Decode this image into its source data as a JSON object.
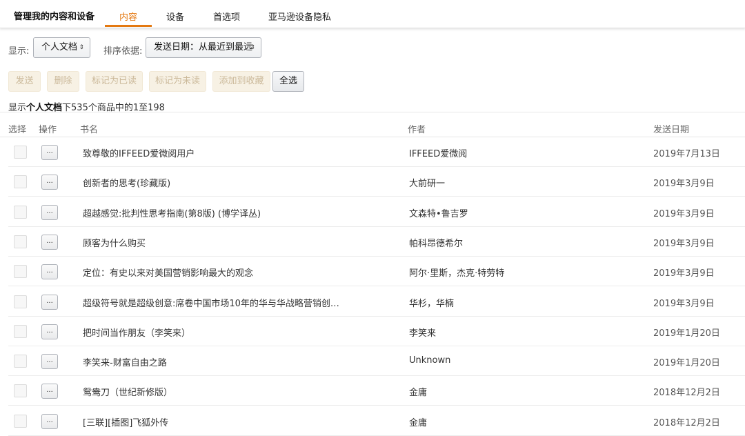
{
  "header": {
    "title": "管理我的内容和设备",
    "tabs": [
      {
        "label": "内容",
        "active": true
      },
      {
        "label": "设备",
        "active": false
      },
      {
        "label": "首选项",
        "active": false
      },
      {
        "label": "亚马逊设备隐私",
        "active": false
      }
    ]
  },
  "filters": {
    "show_label": "显示:",
    "show_value": "个人文档",
    "sort_label": "排序依据:",
    "sort_value": "发送日期：从最近到最远"
  },
  "actions": {
    "send": "发送",
    "delete": "删除",
    "mark_read": "标记为已读",
    "mark_unread": "标记为未读",
    "add_collection": "添加到收藏",
    "select_all": "全选"
  },
  "summary": {
    "prefix": "显示",
    "category": "个人文档",
    "suffix": "下535个商品中的1至198"
  },
  "columns": {
    "select": "选择",
    "action": "操作",
    "title": "书名",
    "author": "作者",
    "date": "发送日期"
  },
  "more_label": "...",
  "rows": [
    {
      "title": "致尊敬的IFFEED爱微阅用户",
      "author": "IFFEED爱微阅",
      "date": "2019年7月13日"
    },
    {
      "title": "创新者的思考(珍藏版)",
      "author": "大前研一",
      "date": "2019年3月9日"
    },
    {
      "title": "超越感觉:批判性思考指南(第8版) (博学译丛)",
      "author": "文森特•鲁吉罗",
      "date": "2019年3月9日"
    },
    {
      "title": "顾客为什么购买",
      "author": "帕科昂德希尔",
      "date": "2019年3月9日"
    },
    {
      "title": "定位：有史以来对美国营销影响最大的观念",
      "author": "阿尔·里斯，杰克·特劳特",
      "date": "2019年3月9日"
    },
    {
      "title": "超级符号就是超级创意:席卷中国市场10年的华与华战略营销创…",
      "author": "华杉，华楠",
      "date": "2019年3月9日"
    },
    {
      "title": "把时间当作朋友（李笑来）",
      "author": "李笑来",
      "date": "2019年1月20日"
    },
    {
      "title": "李笑来-财富自由之路",
      "author": "Unknown",
      "date": "2019年1月20日"
    },
    {
      "title": "鸳鸯刀（世纪新修版）",
      "author": "金庸",
      "date": "2018年12月2日"
    },
    {
      "title": "[三联][插图]飞狐外传",
      "author": "金庸",
      "date": "2018年12月2日"
    }
  ]
}
